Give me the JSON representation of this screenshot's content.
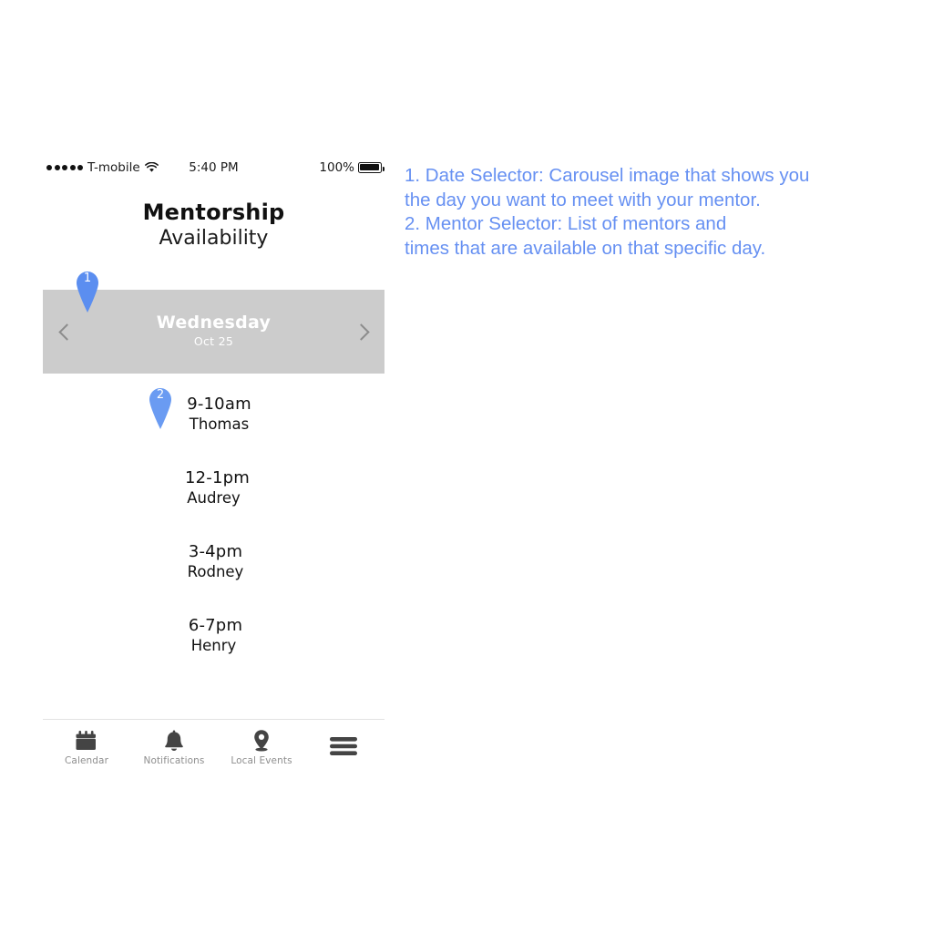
{
  "statusbar": {
    "signal_icon": "signal-dots-icon",
    "carrier": "T-mobile",
    "wifi_icon": "wifi-icon",
    "time": "5:40 PM",
    "battery_percent": "100%",
    "battery_icon": "battery-full-icon"
  },
  "header": {
    "title": "Mentorship",
    "subtitle": "Availability"
  },
  "date_selector": {
    "prev_icon": "chevron-left-icon",
    "next_icon": "chevron-right-icon",
    "day": "Wednesday",
    "date": "Oct 25",
    "background_color": "#cccccc",
    "text_color": "#ffffff"
  },
  "mentor_list": [
    {
      "time": "9-10am",
      "name": "Thomas"
    },
    {
      "time": "12-1pm",
      "name": "Audrey"
    },
    {
      "time": "3-4pm",
      "name": "Rodney"
    },
    {
      "time": "6-7pm",
      "name": "Henry"
    }
  ],
  "bottom_nav": [
    {
      "label": "Calendar",
      "icon": "calendar-icon"
    },
    {
      "label": "Notifications",
      "icon": "bell-icon"
    },
    {
      "label": "Local Events",
      "icon": "map-pin-icon"
    },
    {
      "label": "",
      "icon": "hamburger-menu-icon"
    }
  ],
  "callouts": [
    {
      "number": "1",
      "target": "date-selector"
    },
    {
      "number": "2",
      "target": "mentor-list"
    }
  ],
  "annotation": {
    "color": "#6690f2",
    "lines": [
      "1. Date Selector: Carousel image that shows you",
      "the day you want to meet with your mentor.",
      "2. Mentor Selector: List of mentors and",
      "times that are available on that specific day."
    ]
  }
}
